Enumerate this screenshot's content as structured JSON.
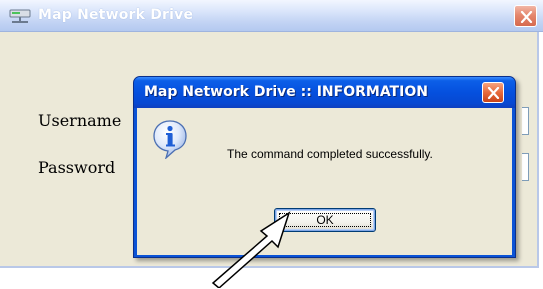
{
  "background_window": {
    "title": "Map Network Drive",
    "fields": [
      {
        "label": "Username"
      },
      {
        "label": "Password"
      }
    ]
  },
  "dialog": {
    "title": "Map Network Drive :: INFORMATION",
    "icon": "information-icon",
    "message": "The command completed successfully.",
    "ok_label": "OK"
  },
  "annotation": {
    "icon": "pointer-arrow-icon"
  },
  "colors": {
    "titlebar_active": "#0550de",
    "titlebar_inactive": "#c3d4f4",
    "close_red": "#e76a3c",
    "dialog_bg": "#ece9d8",
    "info_icon_blue": "#1f5fd6"
  }
}
